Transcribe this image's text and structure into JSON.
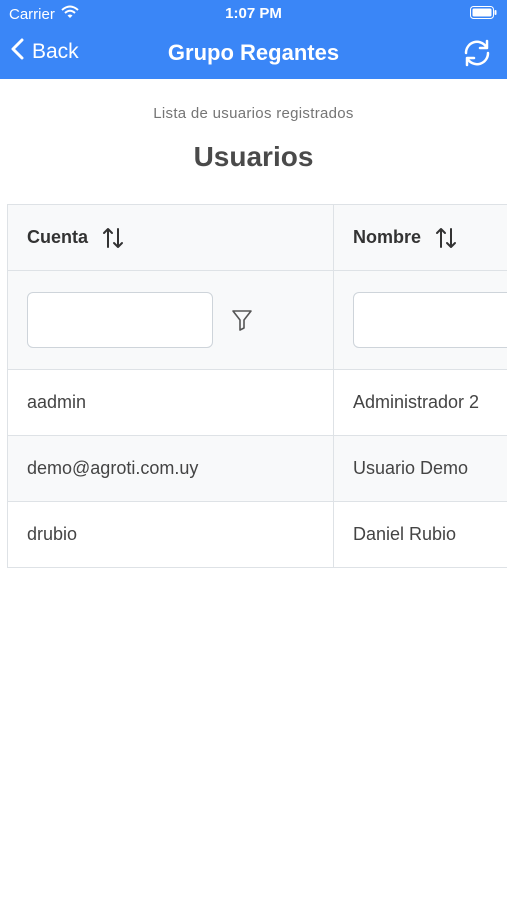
{
  "status_bar": {
    "carrier": "Carrier",
    "time": "1:07 PM"
  },
  "nav": {
    "back_label": "Back",
    "title": "Grupo Regantes",
    "refresh_icon": "refresh-icon"
  },
  "page": {
    "subtitle": "Lista de usuarios registrados",
    "heading": "Usuarios"
  },
  "table": {
    "columns": [
      {
        "label": "Cuenta",
        "sort_icon": "sort-icon",
        "filter_icon": "filter-icon"
      },
      {
        "label": "Nombre",
        "sort_icon": "sort-icon"
      }
    ],
    "filter_values": [
      "",
      ""
    ],
    "rows": [
      [
        "aadmin",
        "Administrador 2"
      ],
      [
        "demo@agroti.com.uy",
        "Usuario Demo"
      ],
      [
        "drubio",
        "Daniel Rubio"
      ]
    ]
  },
  "colors": {
    "header_bg": "#3a86f7",
    "header_text": "#ffffff",
    "table_border": "#dee2e6",
    "table_header_bg": "#f8f9fa"
  }
}
